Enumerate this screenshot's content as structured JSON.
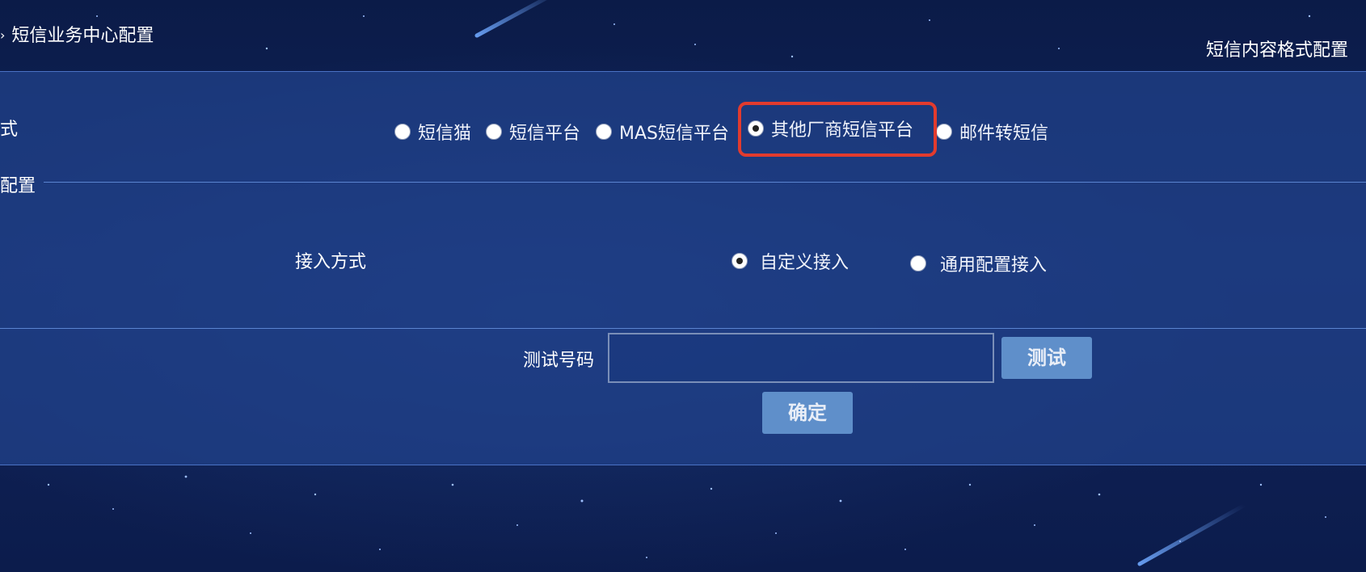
{
  "header": {
    "breadcrumb_arrow": "›",
    "breadcrumb_title": "短信业务中心配置",
    "right_link": "短信内容格式配置"
  },
  "method_row": {
    "label": "式",
    "options": [
      {
        "label": "短信猫",
        "checked": false
      },
      {
        "label": "短信平台",
        "checked": false
      },
      {
        "label": "MAS短信平台",
        "checked": false
      },
      {
        "label": "其他厂商短信平台",
        "checked": true
      },
      {
        "label": "邮件转短信",
        "checked": false
      }
    ]
  },
  "section": {
    "title": "配置"
  },
  "access_row": {
    "label": "接入方式",
    "options": [
      {
        "label": "自定义接入",
        "checked": true
      },
      {
        "label": "通用配置接入",
        "checked": false
      }
    ]
  },
  "test_row": {
    "label": "测试号码",
    "input_value": "",
    "test_button": "测试",
    "confirm_button": "确定"
  },
  "colors": {
    "highlight": "#e23b2e",
    "button": "#5f8fca",
    "panel": "#21428c"
  }
}
